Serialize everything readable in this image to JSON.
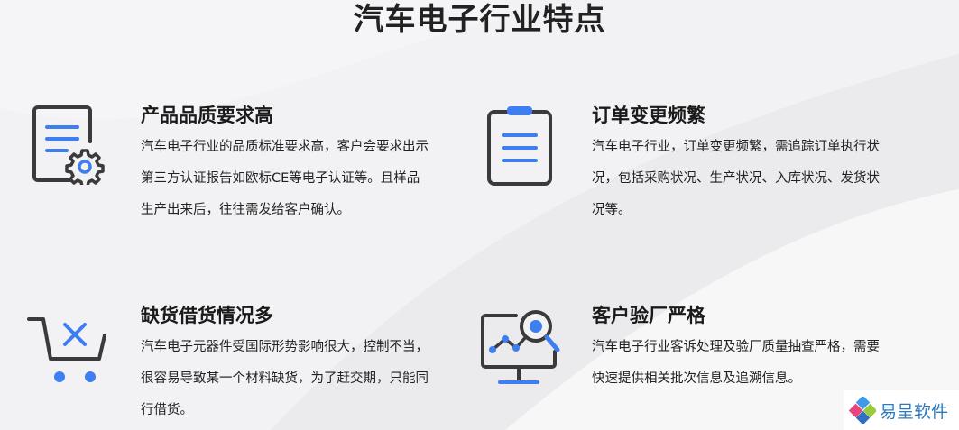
{
  "title": "汽车电子行业特点",
  "features": [
    {
      "title": "产品品质要求高",
      "icon": "document-gear-icon",
      "lines": [
        "汽车电子行业的品质标准要求高，客户会要求出示",
        "第三方认证报告如欧标CE等电子认证等。且样品",
        "生产出来后，往往需发给客户确认。"
      ]
    },
    {
      "title": "订单变更频繁",
      "icon": "clipboard-list-icon",
      "lines": [
        "汽车电子行业，订单变更频繁，需追踪订单执行状",
        "况，包括采购状况、生产状况、入库状况、发货状",
        "况等。"
      ]
    },
    {
      "title": "缺货借货情况多",
      "icon": "cart-x-icon",
      "lines": [
        "汽车电子元器件受国际形势影响很大，控制不当，",
        "很容易导致某一个材料缺货，为了赶交期，只能同",
        "行借货。"
      ]
    },
    {
      "title": "客户验厂严格",
      "icon": "monitor-chart-magnifier-icon",
      "lines": [
        "汽车电子行业客诉处理及验厂质量抽查严格，需要",
        "快速提供相关批次信息及追溯信息。"
      ]
    }
  ],
  "logo": {
    "text": "易呈软件"
  },
  "colors": {
    "accent": "#3d7ef0",
    "icon_dark": "#3a3a3a",
    "background": "#f2f2f4"
  }
}
